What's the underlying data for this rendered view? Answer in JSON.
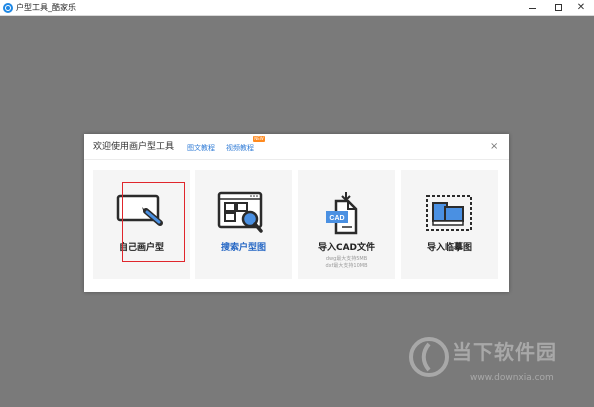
{
  "window": {
    "title": "户型工具_酷家乐",
    "minimize_icon": "minimize-icon",
    "maximize_icon": "maximize-icon",
    "close_symbol": "✕"
  },
  "dialog": {
    "title": "欢迎使用画户型工具",
    "links": [
      {
        "label": "图文教程"
      },
      {
        "label": "视频教程"
      }
    ],
    "badge": "NEW",
    "close_symbol": "×",
    "cards": [
      {
        "label": "自己画户型",
        "icon": "draw-pen-icon"
      },
      {
        "label": "搜索户型图",
        "icon": "search-floorplan-icon",
        "highlighted": true
      },
      {
        "label": "导入CAD文件",
        "icon": "cad-file-icon",
        "notes": [
          "dwg最大支持5MB",
          "dxf最大支持10MB"
        ]
      },
      {
        "label": "导入临摹图",
        "icon": "trace-image-icon"
      }
    ]
  },
  "watermark": {
    "text": "当下软件园",
    "url": "www.downxia.com"
  },
  "colors": {
    "accent": "#2466c4",
    "link": "#2f7bd6",
    "highlight": "#e0262c",
    "badge": "#ff8a1f",
    "workspace": "#7a7a7a"
  }
}
